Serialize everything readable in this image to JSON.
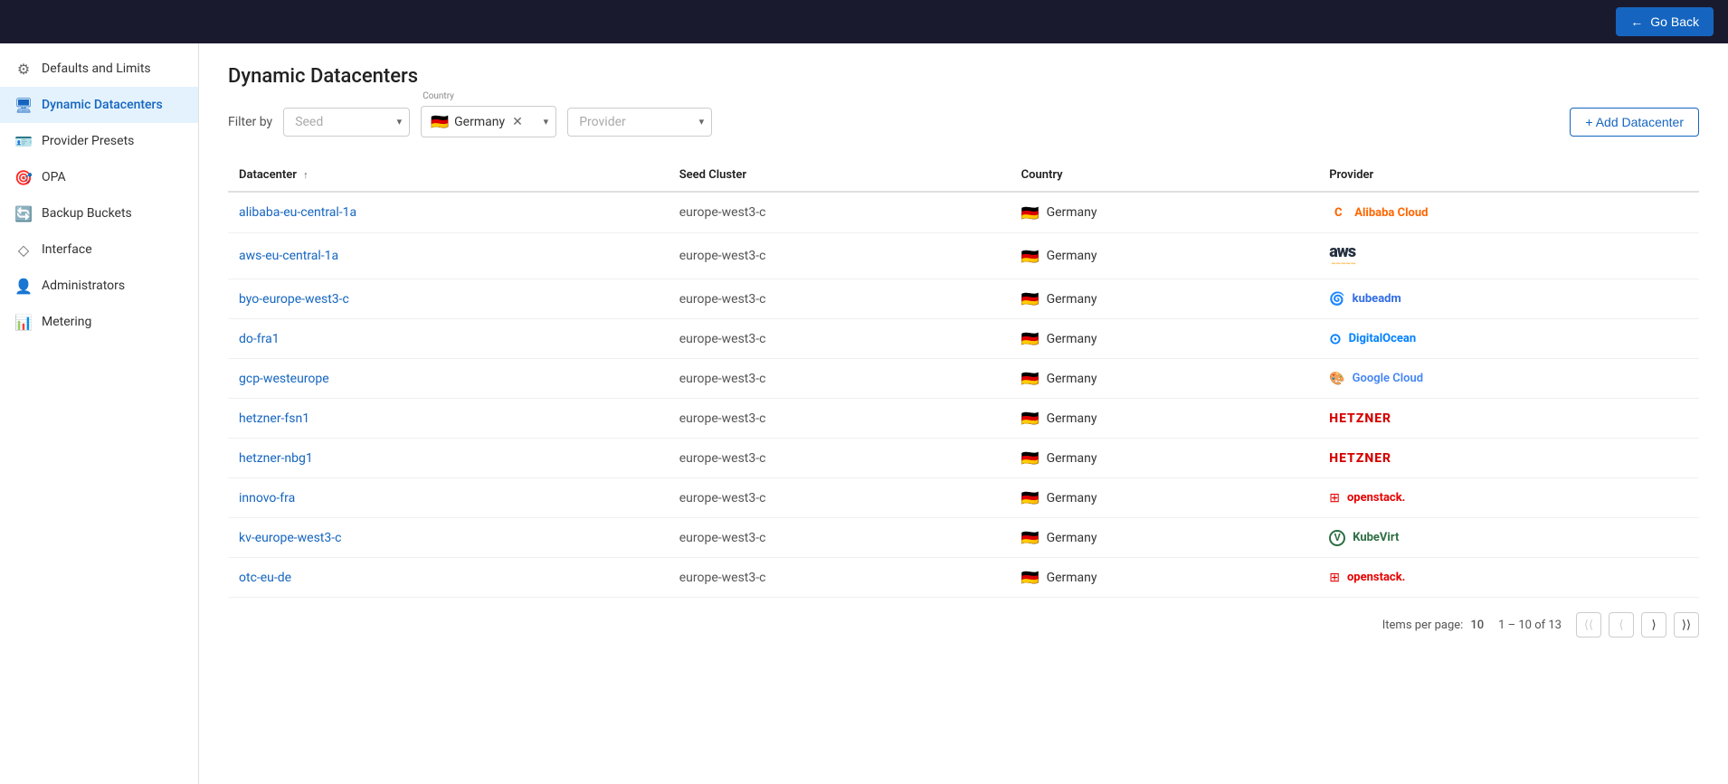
{
  "topbar": {
    "go_back_label": "Go Back"
  },
  "sidebar": {
    "items": [
      {
        "id": "defaults-limits",
        "label": "Defaults and Limits",
        "icon": "⚙"
      },
      {
        "id": "dynamic-datacenters",
        "label": "Dynamic Datacenters",
        "icon": "🖥",
        "active": true
      },
      {
        "id": "provider-presets",
        "label": "Provider Presets",
        "icon": "🪪"
      },
      {
        "id": "opa",
        "label": "OPA",
        "icon": "🎯"
      },
      {
        "id": "backup-buckets",
        "label": "Backup Buckets",
        "icon": "🔄"
      },
      {
        "id": "interface",
        "label": "Interface",
        "icon": "◇"
      },
      {
        "id": "administrators",
        "label": "Administrators",
        "icon": "👤"
      },
      {
        "id": "metering",
        "label": "Metering",
        "icon": "📊"
      }
    ]
  },
  "page": {
    "title": "Dynamic Datacenters",
    "filter_by_label": "Filter by",
    "seed_placeholder": "Seed",
    "country_label": "Country",
    "country_value": "Germany",
    "country_flag": "🇩🇪",
    "provider_placeholder": "Provider",
    "add_datacenter_label": "+ Add Datacenter"
  },
  "table": {
    "columns": [
      {
        "id": "datacenter",
        "label": "Datacenter",
        "sortable": true
      },
      {
        "id": "seed_cluster",
        "label": "Seed Cluster"
      },
      {
        "id": "country",
        "label": "Country"
      },
      {
        "id": "provider",
        "label": "Provider"
      }
    ],
    "rows": [
      {
        "datacenter": "alibaba-eu-central-1a",
        "seed_cluster": "europe-west3-c",
        "country": "Germany",
        "flag": "🇩🇪",
        "provider": "Alibaba Cloud",
        "provider_type": "alibaba"
      },
      {
        "datacenter": "aws-eu-central-1a",
        "seed_cluster": "europe-west3-c",
        "country": "Germany",
        "flag": "🇩🇪",
        "provider": "aws",
        "provider_type": "aws"
      },
      {
        "datacenter": "byo-europe-west3-c",
        "seed_cluster": "europe-west3-c",
        "country": "Germany",
        "flag": "🇩🇪",
        "provider": "kubeadm",
        "provider_type": "kubeadm"
      },
      {
        "datacenter": "do-fra1",
        "seed_cluster": "europe-west3-c",
        "country": "Germany",
        "flag": "🇩🇪",
        "provider": "DigitalOcean",
        "provider_type": "digitalocean"
      },
      {
        "datacenter": "gcp-westeurope",
        "seed_cluster": "europe-west3-c",
        "country": "Germany",
        "flag": "🇩🇪",
        "provider": "Google Cloud",
        "provider_type": "google"
      },
      {
        "datacenter": "hetzner-fsn1",
        "seed_cluster": "europe-west3-c",
        "country": "Germany",
        "flag": "🇩🇪",
        "provider": "HETZNER",
        "provider_type": "hetzner"
      },
      {
        "datacenter": "hetzner-nbg1",
        "seed_cluster": "europe-west3-c",
        "country": "Germany",
        "flag": "🇩🇪",
        "provider": "HETZNER",
        "provider_type": "hetzner"
      },
      {
        "datacenter": "innovo-fra",
        "seed_cluster": "europe-west3-c",
        "country": "Germany",
        "flag": "🇩🇪",
        "provider": "openstack.",
        "provider_type": "openstack"
      },
      {
        "datacenter": "kv-europe-west3-c",
        "seed_cluster": "europe-west3-c",
        "country": "Germany",
        "flag": "🇩🇪",
        "provider": "KubeVirt",
        "provider_type": "kubevirt"
      },
      {
        "datacenter": "otc-eu-de",
        "seed_cluster": "europe-west3-c",
        "country": "Germany",
        "flag": "🇩🇪",
        "provider": "openstack.",
        "provider_type": "openstack"
      }
    ]
  },
  "pagination": {
    "items_per_page_label": "Items per page:",
    "items_per_page": "10",
    "range_label": "1 – 10 of 13"
  }
}
